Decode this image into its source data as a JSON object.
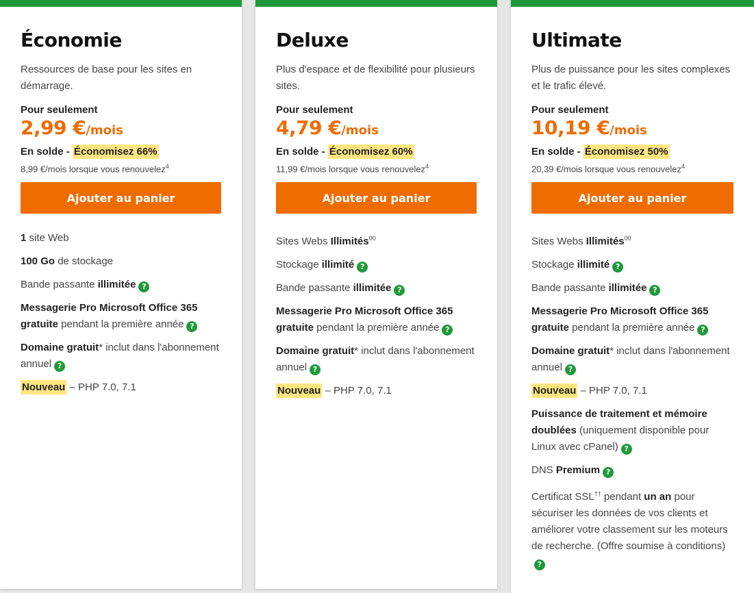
{
  "plans": [
    {
      "name": "Économie",
      "description": "Ressources de base pour les sites en démarrage.",
      "price_intro": "Pour seulement",
      "price": "2,99 €",
      "price_unit": "/mois",
      "sale_prefix": "En solde - ",
      "savings": "Économisez 66%",
      "renew_text": "8,99 €/mois lorsque vous renouvelez",
      "renew_sup": "4",
      "cta": "Ajouter au panier",
      "features": [
        {
          "b1": "1",
          "t1": " site Web"
        },
        {
          "b1": "100 Go",
          "t1": " de stockage"
        },
        {
          "t0": "Bande passante ",
          "b1": "illimitée"
        },
        {
          "b1": "Messagerie Pro Microsoft Office 365 gratuite",
          "t1": " pendant la première année"
        },
        {
          "b1": "Domaine gratuit",
          "t1": "* inclut dans l'abonnement annuel"
        },
        {
          "badge": "Nouveau",
          "t1": " – PHP 7.0, 7.1"
        }
      ]
    },
    {
      "name": "Deluxe",
      "description": "Plus d'espace et de flexibilité pour plusieurs sites.",
      "price_intro": "Pour seulement",
      "price": "4,79 €",
      "price_unit": "/mois",
      "sale_prefix": "En solde - ",
      "savings": "Économisez 60%",
      "renew_text": "11,99 €/mois lorsque vous renouvelez",
      "renew_sup": "4",
      "cta": "Ajouter au panier",
      "features": [
        {
          "t0": "Sites Webs ",
          "b1": "Illimités",
          "sup": "00"
        },
        {
          "t0": "Stockage ",
          "b1": "illimité"
        },
        {
          "t0": "Bande passante ",
          "b1": "illimitée"
        },
        {
          "b1": "Messagerie Pro Microsoft Office 365 gratuite",
          "t1": " pendant la première année"
        },
        {
          "b1": "Domaine gratuit",
          "t1": "* inclut dans l'abonnement annuel"
        },
        {
          "badge": "Nouveau",
          "t1": " – PHP 7.0, 7.1"
        }
      ]
    },
    {
      "name": "Ultimate",
      "description": "Plus de puissance pour les sites complexes et le trafic élevé.",
      "price_intro": "Pour seulement",
      "price": "10,19 €",
      "price_unit": "/mois",
      "sale_prefix": "En solde - ",
      "savings": "Économisez 50%",
      "renew_text": "20,39 €/mois lorsque vous renouvelez",
      "renew_sup": "4",
      "cta": "Ajouter au panier",
      "features": [
        {
          "t0": "Sites Webs ",
          "b1": "Illimités",
          "sup": "00"
        },
        {
          "t0": "Stockage ",
          "b1": "illimité"
        },
        {
          "t0": "Bande passante ",
          "b1": "illimitée"
        },
        {
          "b1": "Messagerie Pro Microsoft Office 365 gratuite",
          "t1": " pendant la première année"
        },
        {
          "b1": "Domaine gratuit",
          "t1": "* inclut dans l'abonnement annuel"
        },
        {
          "badge": "Nouveau",
          "t1": " – PHP 7.0, 7.1"
        },
        {
          "b1": "Puissance de traitement et mémoire doublées",
          "t1": " (uniquement disponible pour Linux avec cPanel)"
        },
        {
          "t0": "DNS ",
          "b1": "Premium"
        },
        {
          "t0": "Certificat SSL",
          "sup2": "††",
          "t2": " pendant ",
          "b2": "un an",
          "t3": " pour sécuriser les données de vos clients et améliorer votre classement sur les moteurs de recherche. (Offre soumise à conditions)"
        }
      ]
    }
  ],
  "info_icon_glyph": "?",
  "colors": {
    "accent_green": "#1f9a3a",
    "orange": "#ef6c00",
    "highlight": "#ffe680"
  }
}
